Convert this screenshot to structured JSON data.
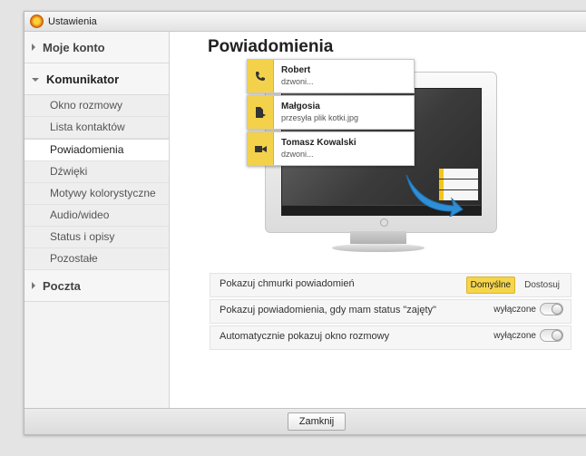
{
  "window": {
    "title": "Ustawienia"
  },
  "sidebar": {
    "sections": [
      {
        "label": "Moje konto",
        "expanded": false
      },
      {
        "label": "Komunikator",
        "expanded": true
      },
      {
        "label": "Poczta",
        "expanded": false
      }
    ],
    "items": [
      {
        "label": "Okno rozmowy"
      },
      {
        "label": "Lista kontaktów"
      },
      {
        "label": "Powiadomienia",
        "active": true
      },
      {
        "label": "Dźwięki"
      },
      {
        "label": "Motywy kolorystyczne"
      },
      {
        "label": "Audio/wideo"
      },
      {
        "label": "Status i opisy"
      },
      {
        "label": "Pozostałe"
      }
    ]
  },
  "main": {
    "title": "Powiadomienia",
    "illustration": {
      "notifications": [
        {
          "name": "Robert",
          "message": "dzwoni...",
          "icon": "phone-icon"
        },
        {
          "name": "Małgosia",
          "message": "przesyła plik kotki.jpg",
          "icon": "file-transfer-icon"
        },
        {
          "name": "Tomasz Kowalski",
          "message": "dzwoni...",
          "icon": "video-camera-icon"
        }
      ]
    },
    "options": [
      {
        "label": "Pokazuj chmurki powiadomień",
        "choices": [
          "Domyślne",
          "Dostosuj"
        ],
        "selected": "Domyślne"
      },
      {
        "label": "Pokazuj powiadomienia, gdy mam status \"zajęty\"",
        "state": "wyłączone"
      },
      {
        "label": "Automatycznie pokazuj okno rozmowy",
        "state": "wyłączone"
      }
    ]
  },
  "footer": {
    "close_label": "Zamknij"
  },
  "colors": {
    "accent": "#f4d54b",
    "sidebar_bg": "#f3f3f3",
    "footer_bg": "#e3e3e3"
  }
}
